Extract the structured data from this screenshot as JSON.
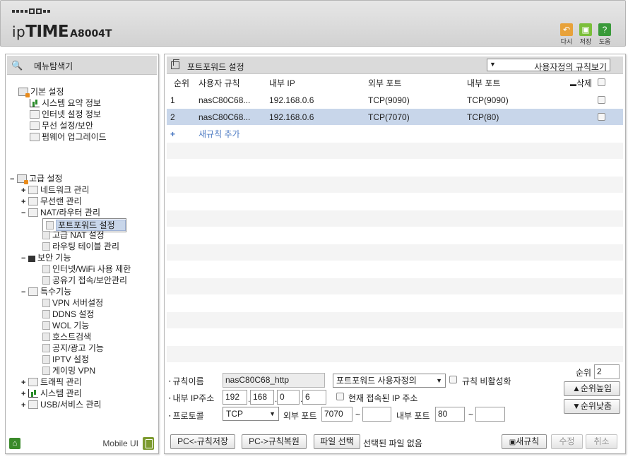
{
  "header": {
    "logo_light": "ip",
    "logo_bold": "TIME",
    "model": "A8004T",
    "buttons": [
      {
        "icon": "undo-icon",
        "label": "다시",
        "color": "#e8a23a"
      },
      {
        "icon": "save-icon",
        "label": "저장",
        "color": "#7bbf3a"
      },
      {
        "icon": "help-icon",
        "label": "도움",
        "color": "#3a9a3a"
      }
    ]
  },
  "sidebar": {
    "title": "메뉴탐색기",
    "basic": {
      "label": "기본 설정",
      "items": [
        "시스템 요약 정보",
        "인터넷 설정 정보",
        "무선 설정/보안",
        "펌웨어 업그레이드"
      ]
    },
    "advanced": {
      "label": "고급 설정",
      "network": "네트워크 관리",
      "wireless": "무선랜 관리",
      "nat": "NAT/라우터 관리",
      "nat_items": [
        "포트포워드 설정",
        "고급 NAT 설정",
        "라우팅 테이블 관리"
      ],
      "security": "보안 기능",
      "security_items": [
        "인터넷/WiFi 사용 제한",
        "공유기 접속/보안관리"
      ],
      "special": "특수기능",
      "special_items": [
        "VPN 서버설정",
        "DDNS 설정",
        "WOL 기능",
        "호스트검색",
        "공지/광고 기능",
        "IPTV 설정",
        "게이밍 VPN"
      ],
      "traffic": "트래픽 관리",
      "system": "시스템 관리",
      "usb": "USB/서비스 관리"
    },
    "mobile_label": "Mobile UI"
  },
  "main": {
    "title": "포트포워드 설정",
    "view_select": "사용자정의 규칙보기",
    "columns": {
      "seq": "순위",
      "rule": "사용자 규칙",
      "ip": "내부 IP",
      "ext": "외부 포트",
      "int": "내부 포트",
      "del": "삭제"
    },
    "rows": [
      {
        "seq": "1",
        "rule": "nasC80C68...",
        "ip": "192.168.0.6",
        "ext": "TCP(9090)",
        "int": "TCP(9090)"
      },
      {
        "seq": "2",
        "rule": "nasC80C68...",
        "ip": "192.168.0.6",
        "ext": "TCP(7070)",
        "int": "TCP(80)"
      }
    ],
    "add_rule": "새규칙 추가"
  },
  "form": {
    "rule_name_label": "규칙이름",
    "rule_name": "nasC80C68_http",
    "rule_type": "포트포워드 사용자정의",
    "disable_label": "규칙 비활성화",
    "ip_label": "내부 IP주소",
    "ip": [
      "192",
      "168",
      "0",
      "6"
    ],
    "current_ip_label": "현재 접속된 IP 주소",
    "protocol_label": "프로토콜",
    "protocol": "TCP",
    "ext_port_label": "외부 포트",
    "ext_port_from": "7070",
    "ext_port_to": "",
    "int_port_label": "내부 포트",
    "int_port_from": "80",
    "int_port_to": "",
    "tilde": "~",
    "priority_label": "순위",
    "priority": "2",
    "up_label": "▲순위높임",
    "down_label": "▼순위낮춤"
  },
  "footer": {
    "save_pc": "PC<-규칙저장",
    "restore_pc": "PC->규칙복원",
    "file_select": "파일 선택",
    "no_file": "선택된 파일 없음",
    "new_rule": "새규칙",
    "modify": "수정",
    "cancel": "취소"
  }
}
